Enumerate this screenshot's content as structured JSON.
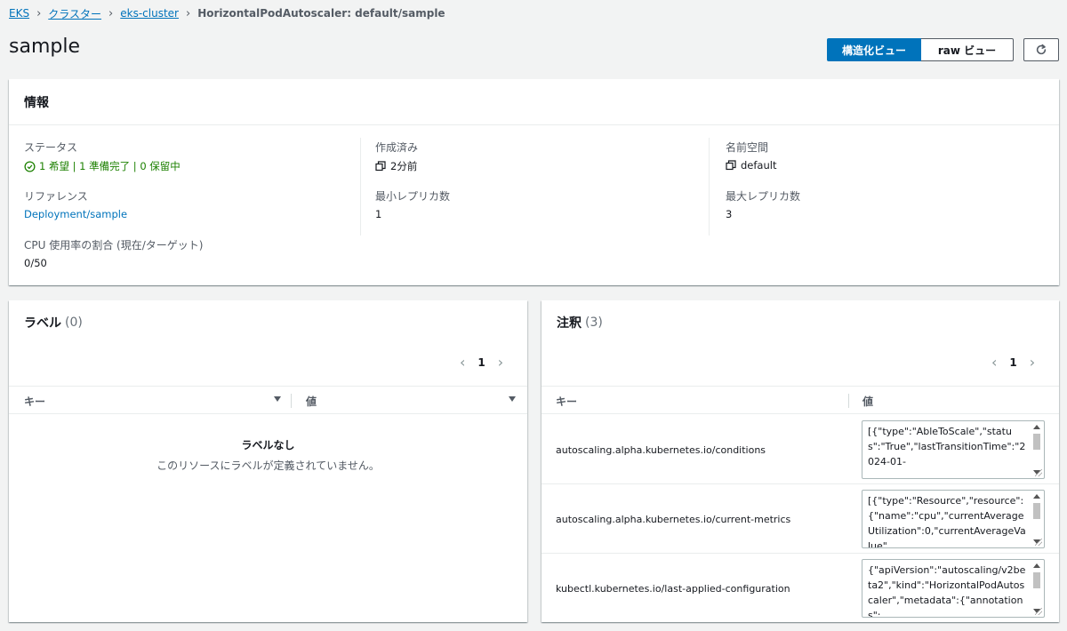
{
  "breadcrumb": {
    "items": [
      "EKS",
      "クラスター",
      "eks-cluster"
    ],
    "current": "HorizontalPodAutoscaler: default/sample"
  },
  "page": {
    "title": "sample",
    "view_structured": "構造化ビュー",
    "view_raw": "raw ビュー",
    "refresh_icon": "refresh-icon"
  },
  "info": {
    "title": "情報",
    "status_label": "ステータス",
    "status_value": "1 希望 | 1 準備完了 | 0 保留中",
    "created_label": "作成済み",
    "created_value": "2分前",
    "namespace_label": "名前空間",
    "namespace_value": "default",
    "reference_label": "リファレンス",
    "reference_value": "Deployment/sample",
    "min_replicas_label": "最小レプリカ数",
    "min_replicas_value": "1",
    "max_replicas_label": "最大レプリカ数",
    "max_replicas_value": "3",
    "cpu_label": "CPU 使用率の割合 (現在/ターゲット)",
    "cpu_value": "0/50",
    "colors": {
      "success": "#1d8102",
      "link": "#0073bb"
    }
  },
  "labels": {
    "title": "ラベル",
    "count": "(0)",
    "page": "1",
    "col_key": "キー",
    "col_value": "値",
    "empty_title": "ラベルなし",
    "empty_desc": "このリソースにラベルが定義されていません。"
  },
  "annotations": {
    "title": "注釈",
    "count": "(3)",
    "page": "1",
    "col_key": "キー",
    "col_value": "値",
    "rows": [
      {
        "key": "autoscaling.alpha.kubernetes.io/conditions",
        "value": "[{\"type\":\"AbleToScale\",\"status\":\"True\",\"lastTransitionTime\":\"2024-01-"
      },
      {
        "key": "autoscaling.alpha.kubernetes.io/current-metrics",
        "value": "[{\"type\":\"Resource\",\"resource\":{\"name\":\"cpu\",\"currentAverageUtilization\":0,\"currentAverageValue\""
      },
      {
        "key": "kubectl.kubernetes.io/last-applied-configuration",
        "value": "{\"apiVersion\":\"autoscaling/v2beta2\",\"kind\":\"HorizontalPodAutoscaler\",\"metadata\":{\"annotations\":"
      }
    ]
  }
}
